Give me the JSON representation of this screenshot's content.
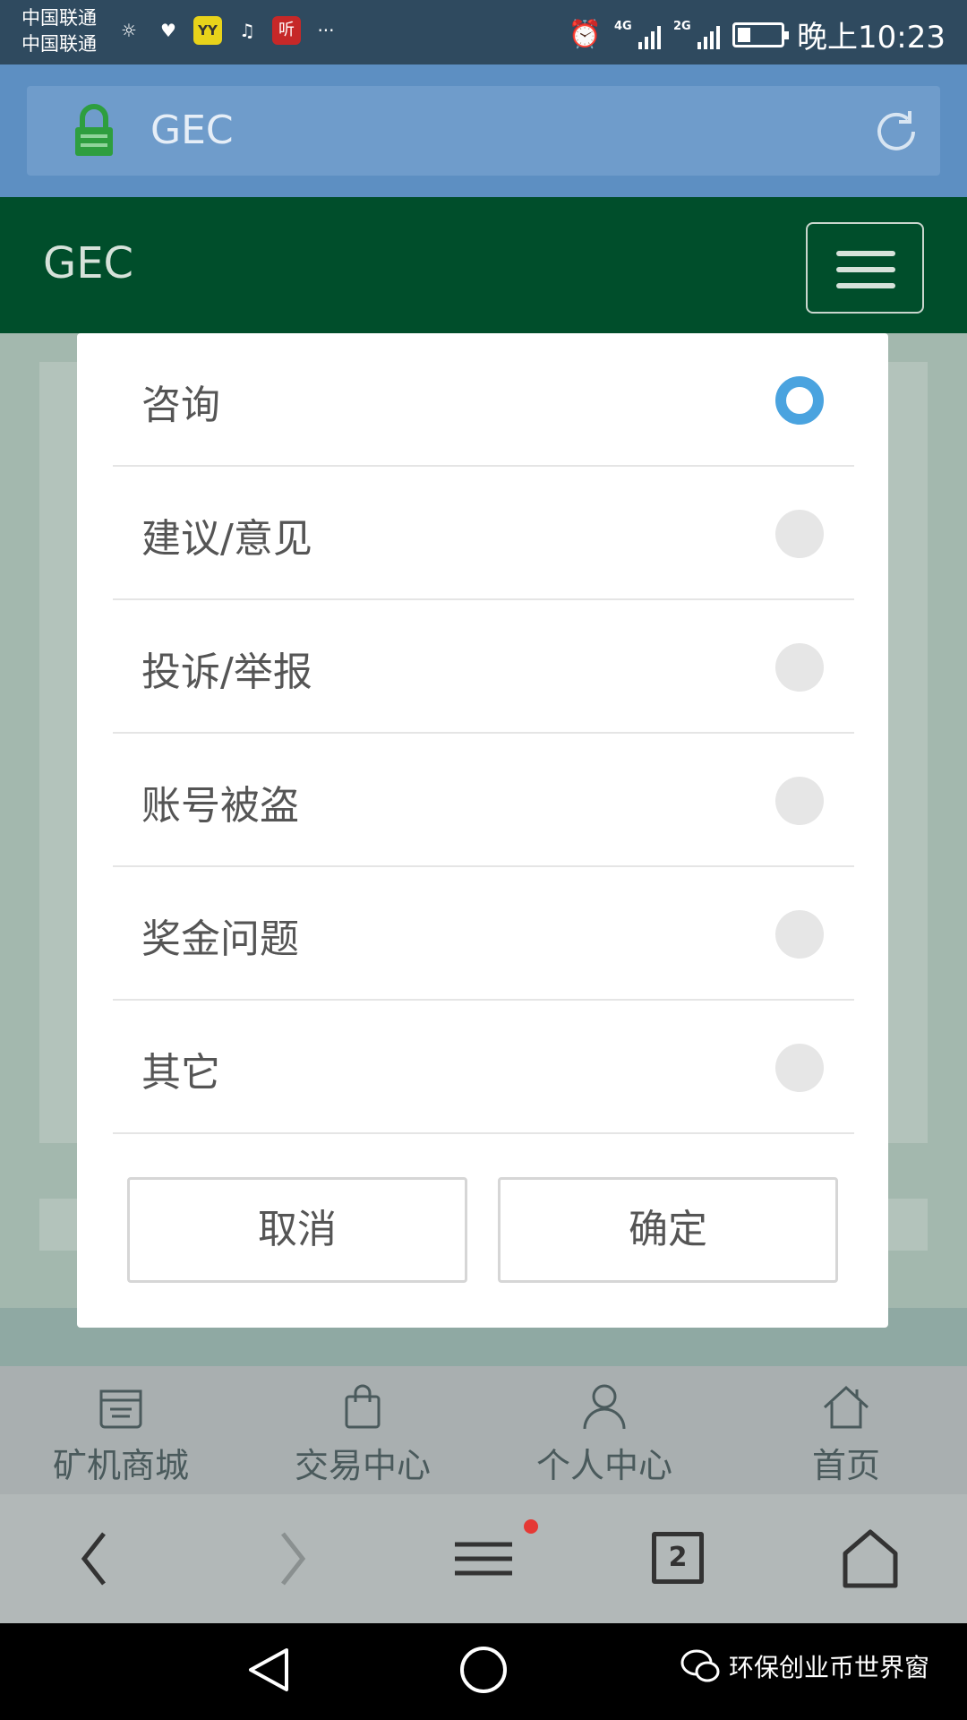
{
  "status_bar": {
    "carrier_1": "中国联通",
    "carrier_2": "中国联通",
    "app_icons": [
      "yy-icon",
      "music-icon",
      "ting-icon"
    ],
    "app_yy": "YY",
    "app_ting": "听",
    "more": "···",
    "net_1": "4G",
    "net_2": "2G",
    "time": "晚上10:23"
  },
  "browser": {
    "url": "GEC",
    "tab_count": "2"
  },
  "site": {
    "title": "GEC"
  },
  "modal": {
    "options": [
      {
        "label": "咨询",
        "selected": true
      },
      {
        "label": "建议/意见",
        "selected": false
      },
      {
        "label": "投诉/举报",
        "selected": false
      },
      {
        "label": "账号被盗",
        "selected": false
      },
      {
        "label": "奖金问题",
        "selected": false
      },
      {
        "label": "其它",
        "selected": false
      }
    ],
    "cancel_label": "取消",
    "confirm_label": "确定"
  },
  "site_nav": {
    "items": [
      {
        "label": "矿机商城",
        "icon": "store-icon"
      },
      {
        "label": "交易中心",
        "icon": "shopping-bag-icon"
      },
      {
        "label": "个人中心",
        "icon": "user-icon"
      },
      {
        "label": "首页",
        "icon": "home-icon"
      }
    ]
  },
  "watermark": "环保创业币世界窗",
  "colors": {
    "header_green": "#004e2b",
    "url_bar_blue": "#5d8fc2",
    "radio_selected": "#4aa3df",
    "notification_dot": "#e53935"
  }
}
